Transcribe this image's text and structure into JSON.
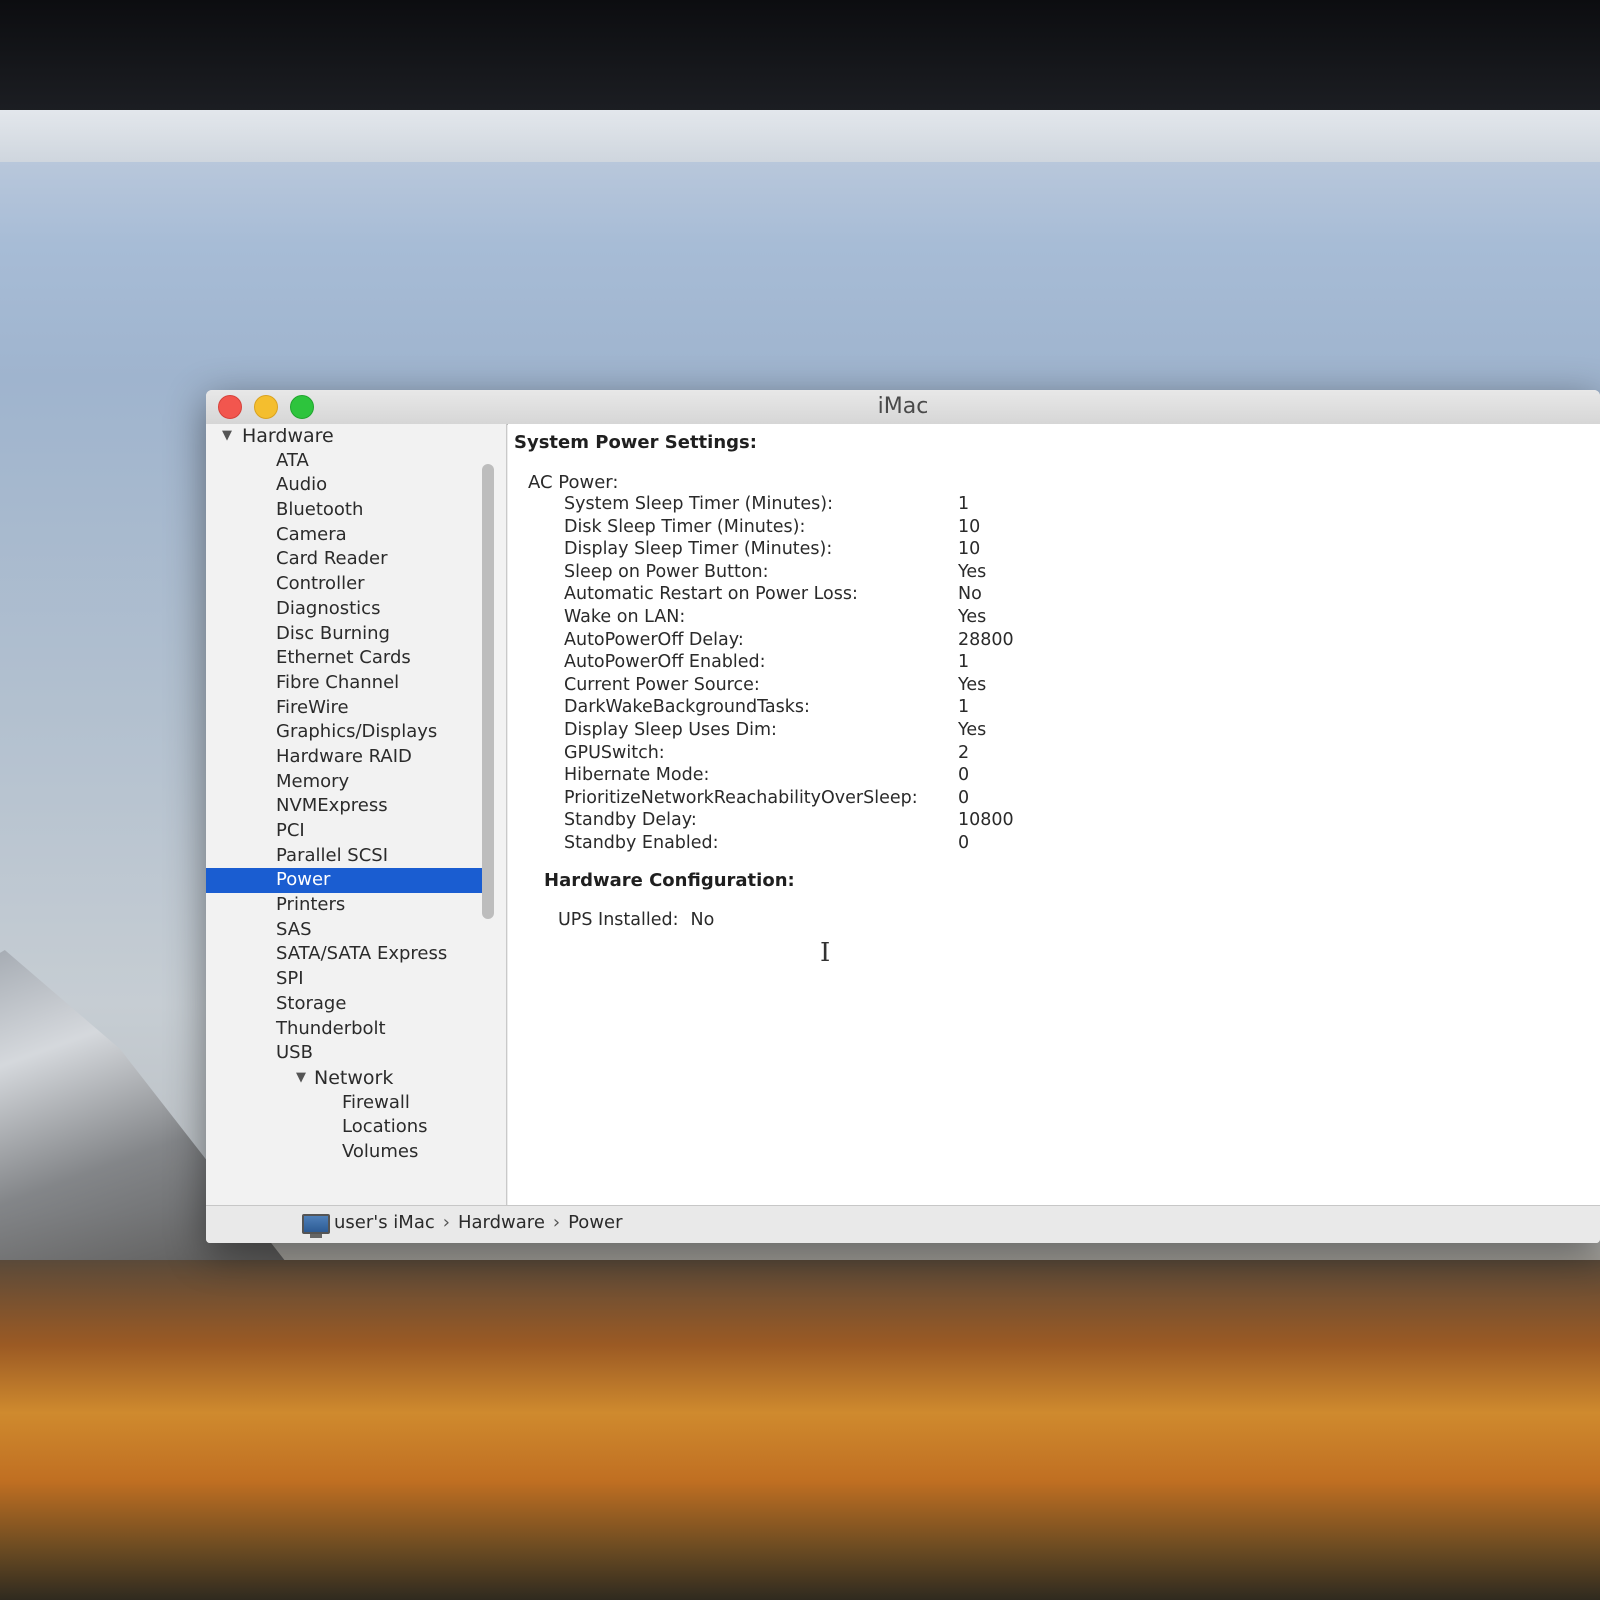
{
  "window": {
    "title": "iMac"
  },
  "sidebar": {
    "items": [
      {
        "label": "Hardware",
        "kind": "group",
        "level": "root"
      },
      {
        "label": "ATA"
      },
      {
        "label": "Audio"
      },
      {
        "label": "Bluetooth"
      },
      {
        "label": "Camera"
      },
      {
        "label": "Card Reader"
      },
      {
        "label": "Controller"
      },
      {
        "label": "Diagnostics"
      },
      {
        "label": "Disc Burning"
      },
      {
        "label": "Ethernet Cards"
      },
      {
        "label": "Fibre Channel"
      },
      {
        "label": "FireWire"
      },
      {
        "label": "Graphics/Displays"
      },
      {
        "label": "Hardware RAID"
      },
      {
        "label": "Memory"
      },
      {
        "label": "NVMExpress"
      },
      {
        "label": "PCI"
      },
      {
        "label": "Parallel SCSI"
      },
      {
        "label": "Power",
        "selected": true
      },
      {
        "label": "Printers"
      },
      {
        "label": "SAS"
      },
      {
        "label": "SATA/SATA Express"
      },
      {
        "label": "SPI"
      },
      {
        "label": "Storage"
      },
      {
        "label": "Thunderbolt"
      },
      {
        "label": "USB"
      },
      {
        "label": "Network",
        "kind": "group",
        "level": "sub"
      },
      {
        "label": "Firewall",
        "netchild": true
      },
      {
        "label": "Locations",
        "netchild": true
      },
      {
        "label": "Volumes",
        "netchild": true
      }
    ]
  },
  "content": {
    "system_heading": "System Power Settings:",
    "ac_power_label": "AC Power:",
    "settings": [
      {
        "label": "System Sleep Timer (Minutes):",
        "value": "1"
      },
      {
        "label": "Disk Sleep Timer (Minutes):",
        "value": "10"
      },
      {
        "label": "Display Sleep Timer (Minutes):",
        "value": "10"
      },
      {
        "label": "Sleep on Power Button:",
        "value": "Yes"
      },
      {
        "label": "Automatic Restart on Power Loss:",
        "value": "No"
      },
      {
        "label": "Wake on LAN:",
        "value": "Yes"
      },
      {
        "label": "AutoPowerOff Delay:",
        "value": "28800"
      },
      {
        "label": "AutoPowerOff Enabled:",
        "value": "1"
      },
      {
        "label": "Current Power Source:",
        "value": "Yes"
      },
      {
        "label": "DarkWakeBackgroundTasks:",
        "value": "1"
      },
      {
        "label": "Display Sleep Uses Dim:",
        "value": "Yes"
      },
      {
        "label": "GPUSwitch:",
        "value": "2"
      },
      {
        "label": "Hibernate Mode:",
        "value": "0"
      },
      {
        "label": "PrioritizeNetworkReachabilityOverSleep:",
        "value": "0"
      },
      {
        "label": "Standby Delay:",
        "value": "10800"
      },
      {
        "label": "Standby Enabled:",
        "value": "0"
      }
    ],
    "hardware_heading": "Hardware Configuration:",
    "ups_label": "UPS Installed:",
    "ups_value": "No"
  },
  "pathbar": {
    "icon": "computer-icon",
    "items": [
      "user's iMac",
      "Hardware",
      "Power"
    ],
    "separator": "›"
  },
  "colors": {
    "selection": "#1a5dd1",
    "close": "#f2564e",
    "minimize": "#f4be2e",
    "zoom": "#2dc43d"
  }
}
